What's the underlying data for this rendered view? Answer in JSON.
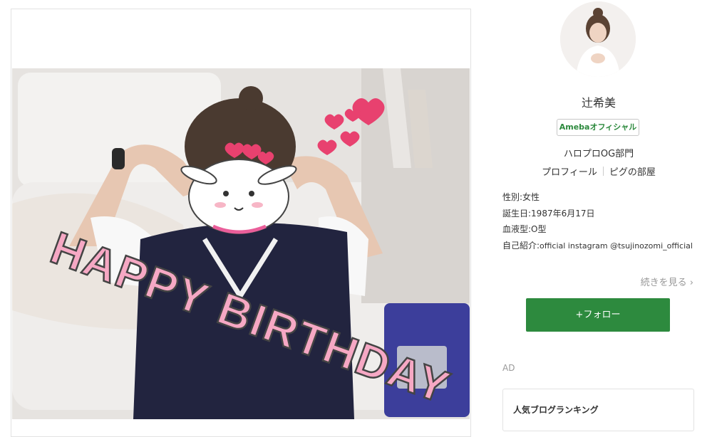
{
  "post": {
    "image_alt": "",
    "overlay_text": "HAPPY BIRTHDAY"
  },
  "profile": {
    "name": "辻希美",
    "badge": "Amebaオフィシャル",
    "category": "ハロプロOG部門",
    "links": [
      "プロフィール",
      "ピグの部屋"
    ],
    "gender_label": "性別:",
    "gender_value": "女性",
    "birthday_label": "誕生日:",
    "birthday_value": "1987年6月17日",
    "blood_label": "血液型:",
    "blood_value": "O型",
    "intro_label": "自己紹介:",
    "intro_value": "official instagram @tsujinozomi_official",
    "read_more": "続きを見る",
    "follow": "+フォロー"
  },
  "ad": {
    "label": "AD"
  },
  "ranking": {
    "title": "人気ブログランキング"
  },
  "colors": {
    "accent": "#2d8a3e",
    "border": "#e2e2e2",
    "muted": "#999999"
  }
}
